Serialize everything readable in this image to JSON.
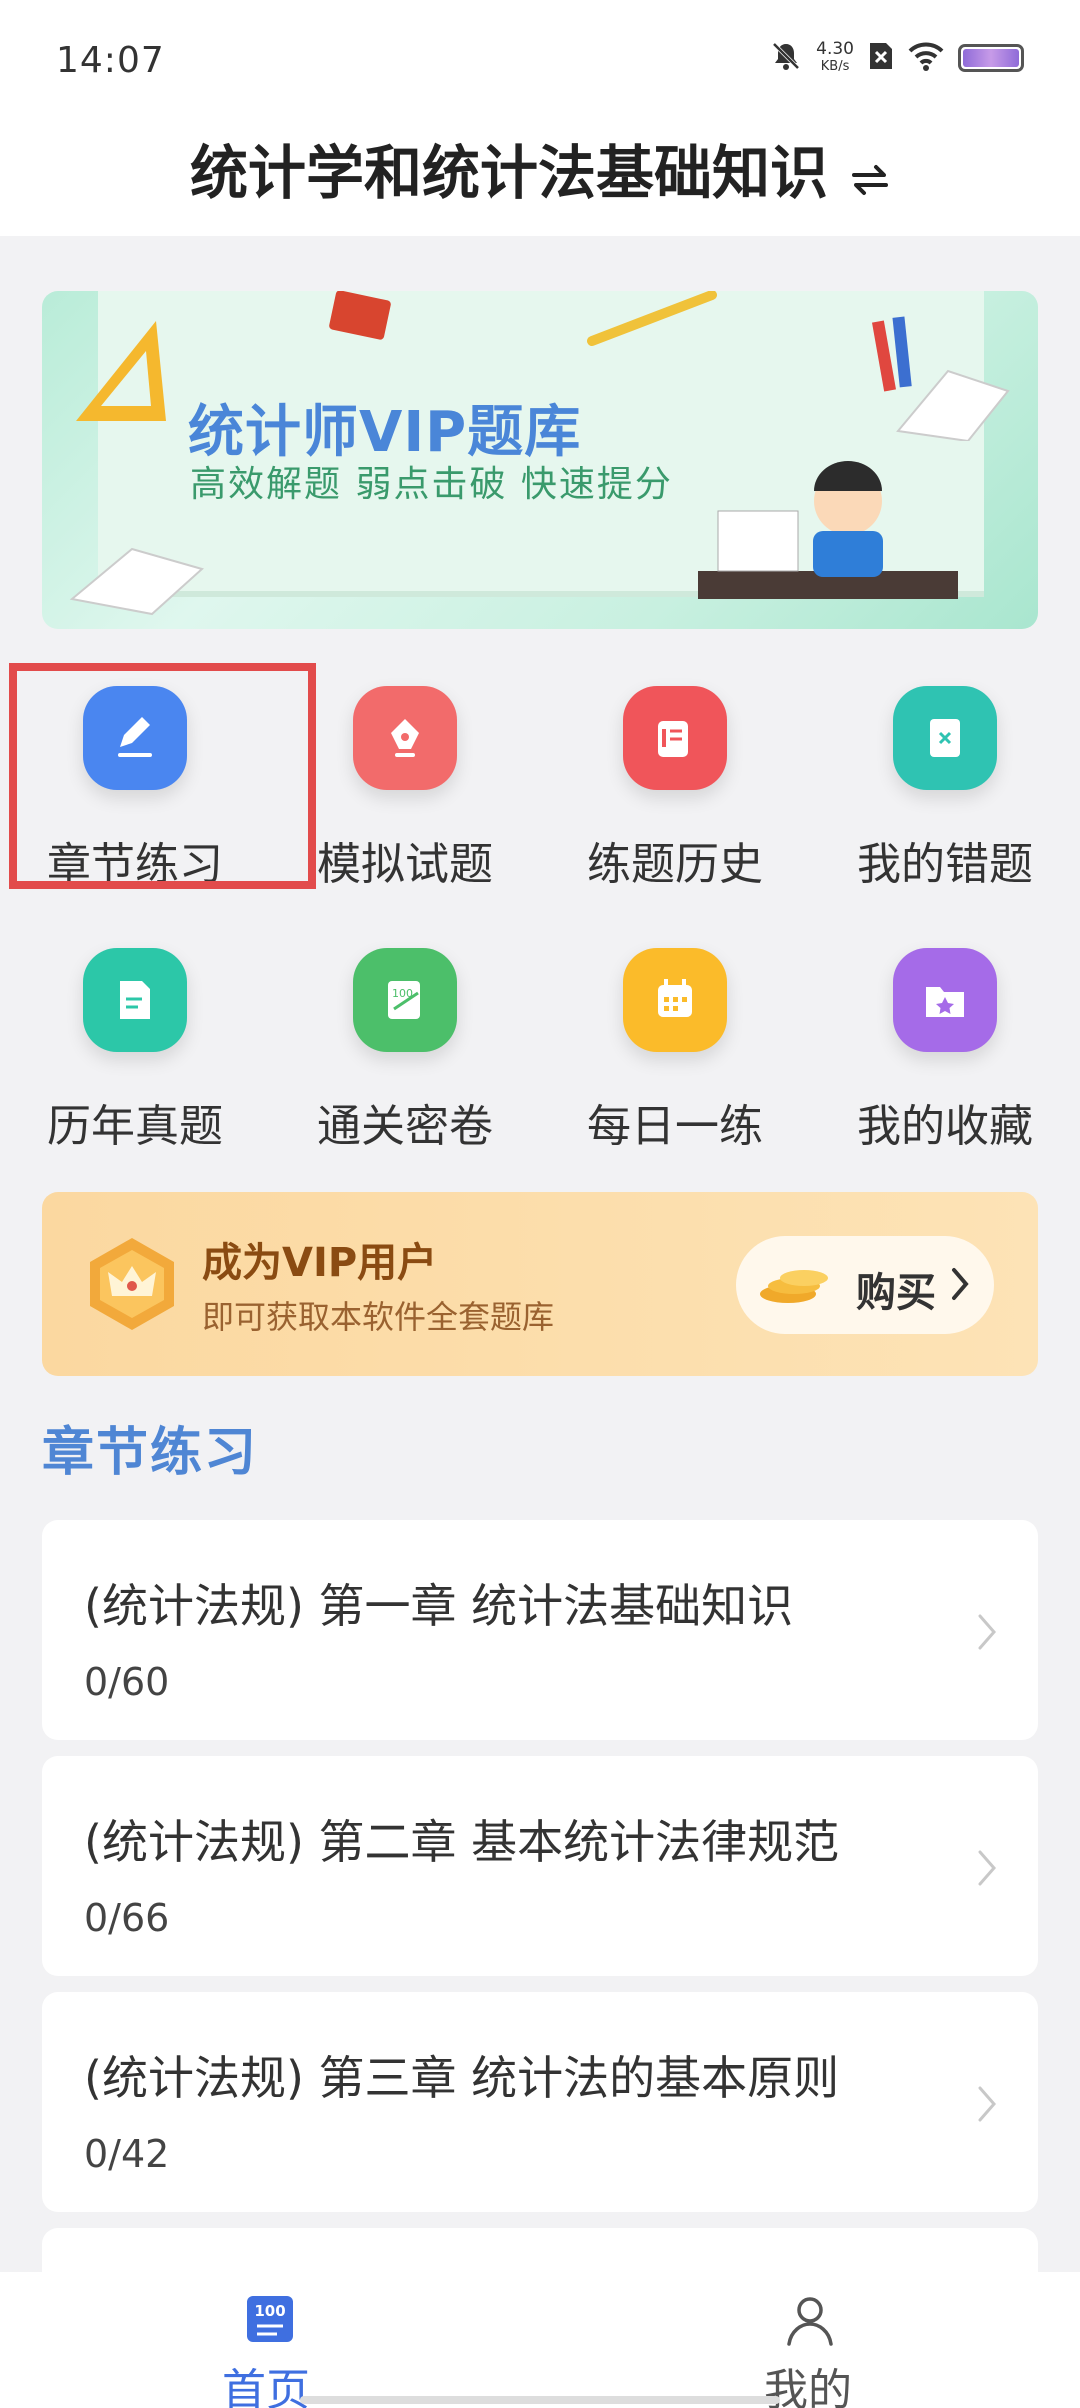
{
  "status_bar": {
    "time": "14:07",
    "net_speed_value": "4.30",
    "net_speed_unit": "KB/s"
  },
  "header": {
    "title": "统计学和统计法基础知识"
  },
  "banner": {
    "title": "统计师VIP题库",
    "subtitle": "高效解题 弱点击破 快速提分"
  },
  "grid": [
    {
      "label": "章节练习",
      "icon": "pencil-icon",
      "color": "#4a86f0"
    },
    {
      "label": "模拟试题",
      "icon": "pen-nib-icon",
      "color": "#f26b6b"
    },
    {
      "label": "练题历史",
      "icon": "history-list-icon",
      "color": "#f0555a"
    },
    {
      "label": "我的错题",
      "icon": "wrong-notebook-icon",
      "color": "#2fc3b2"
    },
    {
      "label": "历年真题",
      "icon": "document-icon",
      "color": "#2cc7a8"
    },
    {
      "label": "通关密卷",
      "icon": "score-paper-icon",
      "color": "#4cbf6a"
    },
    {
      "label": "每日一练",
      "icon": "calendar-icon",
      "color": "#fbbb2a"
    },
    {
      "label": "我的收藏",
      "icon": "star-folder-icon",
      "color": "#a56be8"
    }
  ],
  "vip": {
    "title": "成为VIP用户",
    "subtitle": "即可获取本软件全套题库",
    "buy_label": "购买"
  },
  "section": {
    "title": "章节练习"
  },
  "chapters": [
    {
      "title": "(统计法规) 第一章 统计法基础知识",
      "progress": "0/60"
    },
    {
      "title": "(统计法规) 第二章 基本统计法律规范",
      "progress": "0/66"
    },
    {
      "title": "(统计法规) 第三章 统计法的基本原则",
      "progress": "0/42"
    }
  ],
  "tabbar": {
    "home_label": "首页",
    "home_icon_text": "100",
    "mine_label": "我的",
    "active_color": "#3f6fe0",
    "inactive_color": "#555555"
  }
}
